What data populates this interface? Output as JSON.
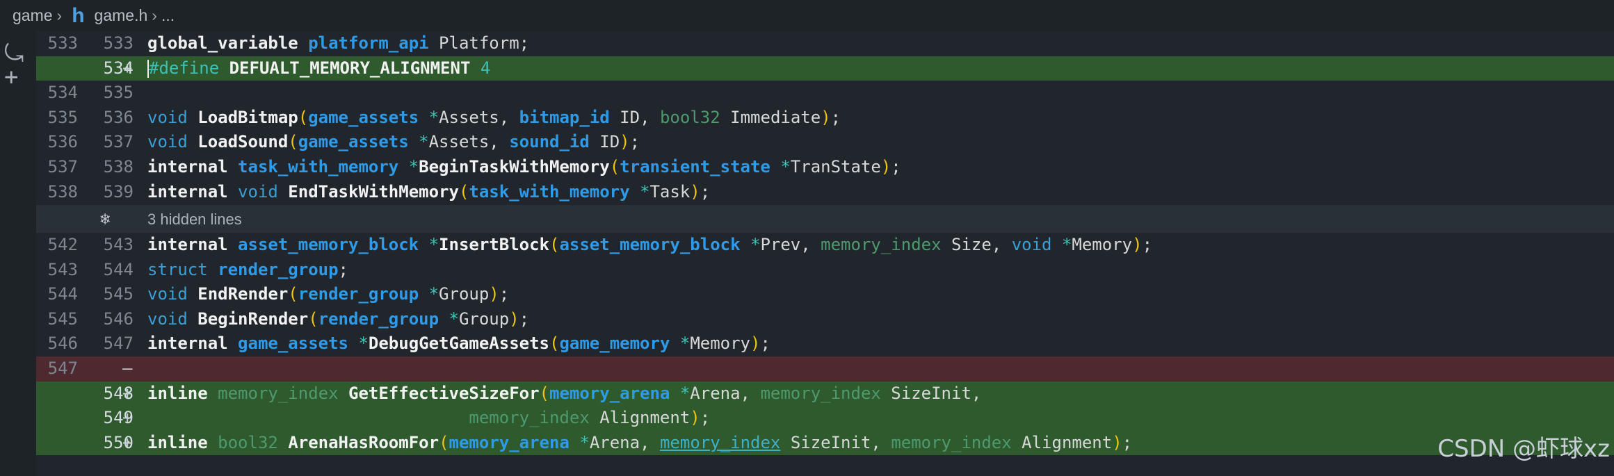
{
  "breadcrumb": {
    "folder": "game",
    "file_icon": "h",
    "file": "game.h",
    "more": "..."
  },
  "gutter_icons": [
    "undo-icon",
    "add-icon"
  ],
  "lines": [
    {
      "old": "533",
      "new": "533",
      "code": "global_variable platform_api Platform;"
    },
    {
      "old": "",
      "new": "534",
      "marker": "+",
      "code": "#define DEFUALT_MEMORY_ALIGNMENT 4"
    },
    {
      "old": "534",
      "new": "535",
      "code": ""
    },
    {
      "old": "535",
      "new": "536",
      "code": "void LoadBitmap(game_assets *Assets, bitmap_id ID, bool32 Immediate);"
    },
    {
      "old": "536",
      "new": "537",
      "code": "void LoadSound(game_assets *Assets, sound_id ID);"
    },
    {
      "old": "537",
      "new": "538",
      "code": "internal task_with_memory *BeginTaskWithMemory(transient_state *TranState);"
    },
    {
      "old": "538",
      "new": "539",
      "code": "internal void EndTaskWithMemory(task_with_memory *Task);"
    },
    {
      "fold": "3 hidden lines"
    },
    {
      "old": "542",
      "new": "543",
      "code": "internal asset_memory_block *InsertBlock(asset_memory_block *Prev, memory_index Size, void *Memory);"
    },
    {
      "old": "543",
      "new": "544",
      "code": "struct render_group;"
    },
    {
      "old": "544",
      "new": "545",
      "code": "void EndRender(render_group *Group);"
    },
    {
      "old": "545",
      "new": "546",
      "code": "void BeginRender(render_group *Group);"
    },
    {
      "old": "546",
      "new": "547",
      "code": "internal game_assets *DebugGetGameAssets(game_memory *Memory);"
    },
    {
      "old": "547",
      "new": "",
      "marker": "—",
      "code": ""
    },
    {
      "old": "",
      "new": "548",
      "marker": "+",
      "code": "inline memory_index GetEffectiveSizeFor(memory_arena *Arena, memory_index SizeInit,"
    },
    {
      "old": "",
      "new": "549",
      "marker": "+",
      "code": "memory_index Alignment);"
    },
    {
      "old": "",
      "new": "550",
      "marker": "+",
      "code": "inline bool32 ArenaHasRoomFor(memory_arena *Arena, memory_index SizeInit, memory_index Alignment);"
    }
  ],
  "watermark": "CSDN @虾球xz"
}
